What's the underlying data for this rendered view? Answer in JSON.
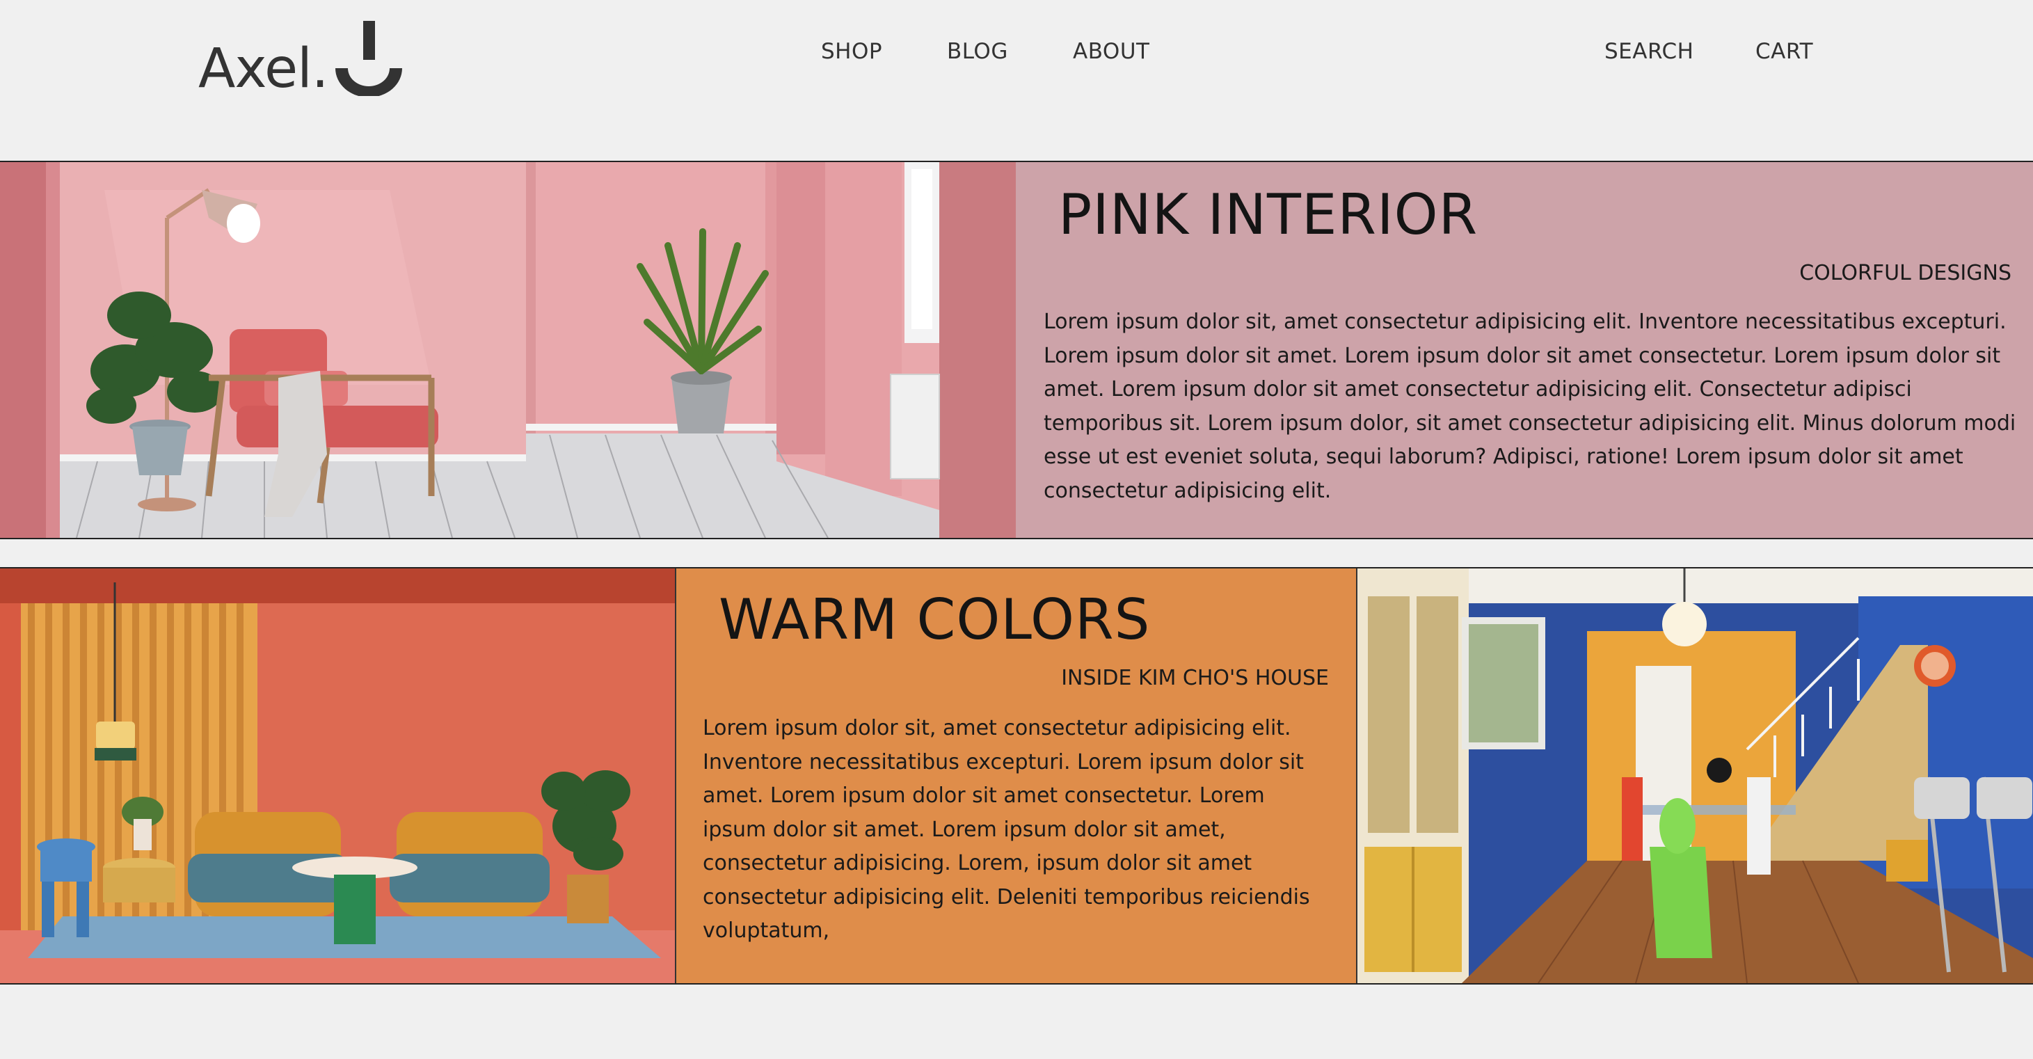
{
  "brand": {
    "name": "Axel."
  },
  "nav": {
    "shop": "SHOP",
    "blog": "BLOG",
    "about": "ABOUT",
    "search": "SEARCH",
    "cart": "CART"
  },
  "sections": [
    {
      "title": "PINK INTERIOR",
      "subtitle": "COLORFUL DESIGNS",
      "text": "Lorem ipsum dolor sit, amet consectetur adipisicing elit. Inventore necessitatibus excepturi. Lorem ipsum dolor sit amet. Lorem ipsum dolor sit amet consectetur. Lorem ipsum dolor sit amet. Lorem ipsum dolor sit amet consectetur adipisicing elit. Consectetur adipisci temporibus sit. Lorem ipsum dolor, sit amet consectetur adipisicing elit. Minus dolorum modi esse ut est eveniet soluta, sequi laborum? Adipisci, ratione! Lorem ipsum dolor sit amet consectetur adipisicing elit.",
      "background": "#cda3a9"
    },
    {
      "title": "WARM COLORS",
      "subtitle": "INSIDE KIM CHO'S HOUSE",
      "text": "Lorem ipsum dolor sit, amet consectetur adipisicing elit. Inventore necessitatibus excepturi. Lorem ipsum dolor sit amet. Lorem ipsum dolor sit amet consectetur. Lorem ipsum dolor sit amet. Lorem ipsum dolor sit amet, consectetur adipisicing. Lorem, ipsum dolor sit amet consectetur adipisicing elit. Deleniti temporibus reiciendis voluptatum,",
      "background": "#df8d4a"
    }
  ]
}
